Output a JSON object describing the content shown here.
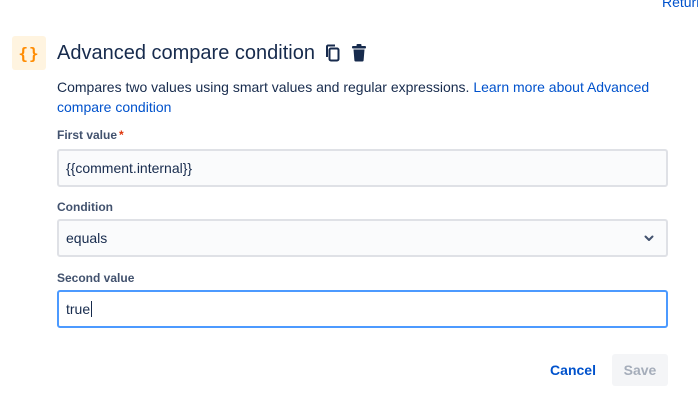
{
  "top_link": "Return",
  "header": {
    "badge_glyph": "{}",
    "title": "Advanced compare condition",
    "copy_icon": "copy-icon",
    "delete_icon": "trash-icon"
  },
  "description": {
    "text": "Compares two values using smart values and regular expressions. ",
    "link_text": "Learn more about Advanced compare condition"
  },
  "fields": {
    "first": {
      "label": "First value",
      "required_mark": "*",
      "value": "{{comment.internal}}"
    },
    "condition": {
      "label": "Condition",
      "value": "equals"
    },
    "second": {
      "label": "Second value",
      "value": "true"
    }
  },
  "buttons": {
    "cancel": "Cancel",
    "save": "Save"
  },
  "colors": {
    "accent": "#0052cc",
    "badge_bg": "#fff4e0",
    "badge_fg": "#ff8b00",
    "focus": "#4c9aff",
    "required": "#de350b"
  }
}
